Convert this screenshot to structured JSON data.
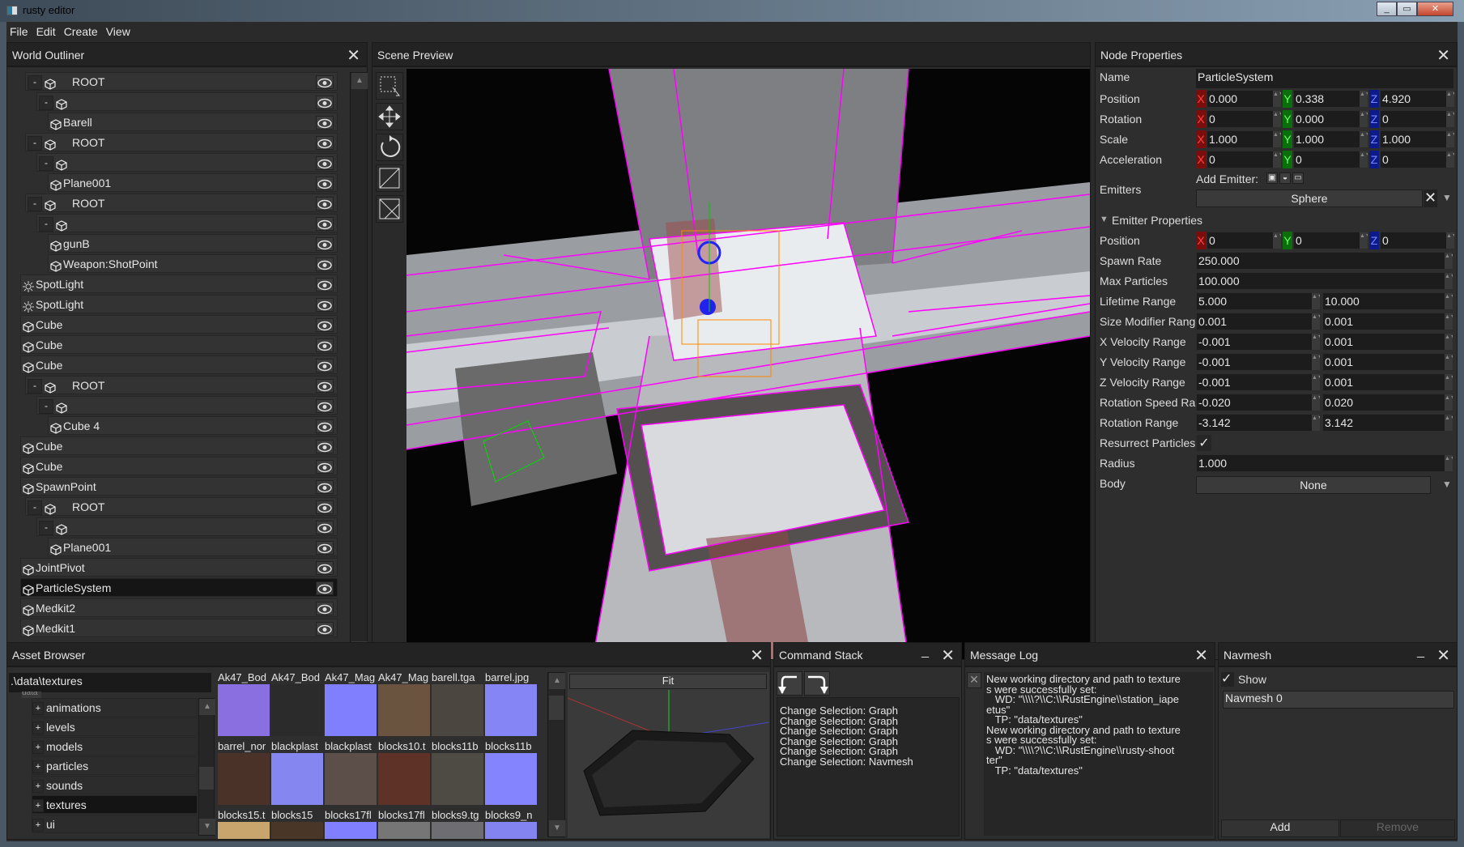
{
  "window": {
    "title": "rusty editor",
    "min": "_",
    "max": "▭",
    "close": "✕"
  },
  "menu": [
    "File",
    "Edit",
    "Create",
    "View"
  ],
  "outliner": {
    "title": "World Outliner",
    "close": "✕",
    "items": [
      {
        "level": 1,
        "label": "ROOT",
        "expander": "-",
        "icon": "cube"
      },
      {
        "level": 2,
        "label": "",
        "expander": "-",
        "icon": "cube"
      },
      {
        "level": 3,
        "label": "Barell",
        "icon": "cube"
      },
      {
        "level": 1,
        "label": "ROOT",
        "expander": "-",
        "icon": "cube"
      },
      {
        "level": 2,
        "label": "",
        "expander": "-",
        "icon": "cube"
      },
      {
        "level": 3,
        "label": "Plane001",
        "icon": "cube"
      },
      {
        "level": 1,
        "label": "ROOT",
        "expander": "-",
        "icon": "cube"
      },
      {
        "level": 2,
        "label": "",
        "expander": "-",
        "icon": "cube"
      },
      {
        "level": 3,
        "label": "gunB",
        "icon": "cube"
      },
      {
        "level": 3,
        "label": "Weapon:ShotPoint",
        "icon": "cube"
      },
      {
        "level": 0,
        "label": "SpotLight",
        "icon": "light"
      },
      {
        "level": 0,
        "label": "SpotLight",
        "icon": "light"
      },
      {
        "level": 0,
        "label": "Cube",
        "icon": "cube"
      },
      {
        "level": 0,
        "label": "Cube",
        "icon": "cube"
      },
      {
        "level": 0,
        "label": "Cube",
        "icon": "cube"
      },
      {
        "level": 1,
        "label": "ROOT",
        "expander": "-",
        "icon": "cube"
      },
      {
        "level": 2,
        "label": "",
        "expander": "-",
        "icon": "cube"
      },
      {
        "level": 3,
        "label": "Cube  4",
        "icon": "cube"
      },
      {
        "level": 0,
        "label": "Cube",
        "icon": "cube"
      },
      {
        "level": 0,
        "label": "Cube",
        "icon": "cube"
      },
      {
        "level": 0,
        "label": "SpawnPoint",
        "icon": "cube"
      },
      {
        "level": 1,
        "label": "ROOT",
        "expander": "-",
        "icon": "cube"
      },
      {
        "level": 2,
        "label": "",
        "expander": "-",
        "icon": "cube"
      },
      {
        "level": 3,
        "label": "Plane001",
        "icon": "cube"
      },
      {
        "level": 0,
        "label": "JointPivot",
        "icon": "cube"
      },
      {
        "level": 0,
        "label": "ParticleSystem",
        "icon": "cube",
        "selected": true
      },
      {
        "level": 0,
        "label": "Medkit2",
        "icon": "cube"
      },
      {
        "level": 0,
        "label": "Medkit1",
        "icon": "cube"
      }
    ]
  },
  "scene": {
    "title": "Scene Preview",
    "tools": [
      "select-icon",
      "move-icon",
      "rotate-icon",
      "scale-icon",
      "navmesh-icon"
    ],
    "wire_color": "#ff00ff"
  },
  "props": {
    "title": "Node Properties",
    "close": "✕",
    "name_label": "Name",
    "name_value": "ParticleSystem",
    "vectors": [
      {
        "label": "Position",
        "x": "0.000",
        "y": "0.338",
        "z": "4.920"
      },
      {
        "label": "Rotation",
        "x": "0",
        "y": "0.000",
        "z": "0"
      },
      {
        "label": "Scale",
        "x": "1.000",
        "y": "1.000",
        "z": "1.000"
      },
      {
        "label": "Acceleration",
        "x": "0",
        "y": "0",
        "z": "0"
      }
    ],
    "axis_labels": {
      "x": "X",
      "y": "Y",
      "z": "Z"
    },
    "emitters_label": "Emitters",
    "add_emitter": "Add Emitter:",
    "emitter_selected": "Sphere",
    "emitter_props_label": "Emitter Properties",
    "emitter_position": {
      "label": "Position",
      "x": "0",
      "y": "0",
      "z": "0"
    },
    "singles": [
      {
        "label": "Spawn Rate",
        "value": "250.000"
      },
      {
        "label": "Max Particles",
        "value": "100.000"
      }
    ],
    "ranges": [
      {
        "label": "Lifetime Range",
        "min": "5.000",
        "max": "10.000"
      },
      {
        "label": "Size Modifier Range",
        "min": "0.001",
        "max": "0.001"
      },
      {
        "label": "X Velocity Range",
        "min": "-0.001",
        "max": "0.001"
      },
      {
        "label": "Y Velocity Range",
        "min": "-0.001",
        "max": "0.001"
      },
      {
        "label": "Z Velocity Range",
        "min": "-0.001",
        "max": "0.001"
      },
      {
        "label": "Rotation Speed Range",
        "min": "-0.020",
        "max": "0.020"
      },
      {
        "label": "Rotation Range",
        "min": "-3.142",
        "max": "3.142"
      }
    ],
    "resurrect_label": "Resurrect Particles",
    "resurrect_checked": true,
    "radius_label": "Radius",
    "radius_value": "1.000",
    "body_label": "Body",
    "body_value": "None"
  },
  "assets": {
    "title": "Asset Browser",
    "close": "✕",
    "path": ".\\data\\textures",
    "root": "data",
    "folders": [
      "animations",
      "levels",
      "models",
      "particles",
      "sounds",
      "textures",
      "ui"
    ],
    "selected_folder": "textures",
    "rows": [
      {
        "labels": [
          "Ak47_Bod",
          "Ak47_Bod",
          "Ak47_Mag",
          "Ak47_Mag",
          "barell.tga",
          "barrel.jpg"
        ],
        "colors": [
          "#8a6fe0",
          "#2b2b2b",
          "#8080ff",
          "#6a5440",
          "#4c4640",
          "#8585f5"
        ]
      },
      {
        "labels": [
          "barrel_nor",
          "blackplast",
          "blackplast",
          "blocks10.t",
          "blocks11b",
          "blocks11b"
        ],
        "colors": [
          "#4a3228",
          "#8686f0",
          "#5c4e48",
          "#5e3226",
          "#4e4a44",
          "#8484ff"
        ]
      },
      {
        "labels": [
          "blocks15.t",
          "blocks15",
          "blocks17fl",
          "blocks17fl",
          "blocks9.tg",
          "blocks9_n"
        ],
        "colors": [
          "#c9a56e",
          "#4a3626",
          "#8080ff",
          "#767676",
          "#6e6e72",
          "#8484f0"
        ]
      }
    ],
    "preview_fit": "Fit"
  },
  "commands": {
    "title": "Command Stack",
    "min": "_",
    "close": "✕",
    "items": [
      "Change Selection: Graph",
      "Change Selection: Graph",
      "Change Selection: Graph",
      "Change Selection: Graph",
      "Change Selection: Graph",
      "Change Selection: Navmesh"
    ]
  },
  "log": {
    "title": "Message Log",
    "close": "✕",
    "clear": "✕",
    "lines": [
      "New working directory and path to texture",
      "s were successfully set:",
      "   WD: \"\\\\\\\\?\\\\C:\\\\RustEngine\\\\station_iape",
      "etus\"",
      "   TP: \"data/textures\"",
      "New working directory and path to texture",
      "s were successfully set:",
      "   WD: \"\\\\\\\\?\\\\C:\\\\RustEngine\\\\rusty-shoot",
      "ter\"",
      "   TP: \"data/textures\""
    ]
  },
  "navmesh": {
    "title": "Navmesh",
    "min": "_",
    "close": "✕",
    "show_label": "Show",
    "show_checked": true,
    "items": [
      "Navmesh 0"
    ],
    "add": "Add",
    "remove": "Remove"
  }
}
